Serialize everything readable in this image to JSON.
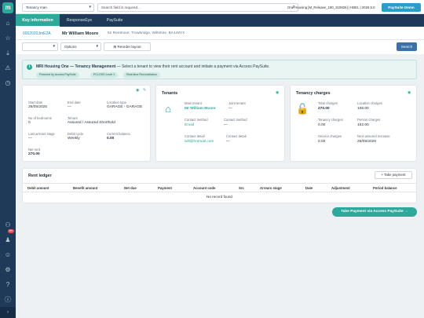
{
  "sidebar": {
    "logo": "m",
    "badge": "99+",
    "collapse_arrow": "›"
  },
  "topbar": {
    "entity_select": "Tenancy man",
    "search_placeholder": "Search field is required...",
    "env": "One Housing [M_Release_190_310826] | HBEL | 2026.5.0",
    "demo_button": "PaySuite Demo"
  },
  "tabs": [
    "Key information",
    "ResponseEye",
    "PaySuite"
  ],
  "record": {
    "id": "0002020JmE2A",
    "name": "Mr William Moore",
    "address": "51 Rentmoor, Trowbridge, Wiltshire, BA148YX"
  },
  "toolbar": {
    "select1": "",
    "options_label": "Options",
    "reorder_label": "Reorder layout",
    "search_label": "Search"
  },
  "banner": {
    "title": "MRI Housing One — Tenancy Management",
    "text": " — Select a tenant to view their rent account and initiate a payment via Access PaySuite.",
    "pills": [
      "Powered by Access PaySuite",
      "PCI-DSS Level 1",
      "Real-time Reconciliation"
    ]
  },
  "tenancy_card": {
    "fields": [
      {
        "label": "Start date",
        "value": "26/05/2025"
      },
      {
        "label": "End date",
        "value": "—"
      },
      {
        "label": "Location type",
        "value": "GARAGE - GARAGE"
      },
      {
        "label": "No of bedrooms",
        "value": "0"
      },
      {
        "label": "Tenure",
        "value": "Assured / Assured Shorthold"
      },
      {
        "label": "Last arrears stage",
        "value": "—"
      },
      {
        "label": "Debit cycle",
        "value": "Weekly"
      },
      {
        "label": "Current balance",
        "value": "0.00"
      },
      {
        "label": "Net rent",
        "value": "270.00"
      }
    ]
  },
  "tenants_card": {
    "title": "Tenants",
    "main_tenant_label": "Main tenant",
    "main_tenant_value": "Mr William Moore",
    "joint_tenant_label": "Joint tenant",
    "joint_tenant_value": "—",
    "contact_method_label": "Contact method",
    "contact_method_value": "Email",
    "contact_method2_label": "Contact method",
    "contact_method2_value": "—",
    "contact_detail_label": "Contact detail",
    "contact_detail_value": "will@hotmail.com",
    "contact_detail2_label": "Contact detail",
    "contact_detail2_value": "—"
  },
  "charges_card": {
    "title": "Tenancy charges",
    "fields": [
      {
        "label": "Total charges",
        "value": "270.00"
      },
      {
        "label": "Location charges",
        "value": "108.00"
      },
      {
        "label": "Tenancy charges",
        "value": "0.00"
      },
      {
        "label": "Person charges",
        "value": "162.00"
      },
      {
        "label": "Service charges",
        "value": "0.00"
      },
      {
        "label": "Next assured increase",
        "value": "26/05/2026"
      }
    ]
  },
  "ledger": {
    "title": "Rent ledger",
    "take_payment": "+ Take payment",
    "columns": [
      "Debit amount",
      "Benefit amount",
      "Net due",
      "Payment",
      "Account code",
      "Src",
      "Arrears stage",
      "Date",
      "Adjustment",
      "Period balance"
    ],
    "empty": "No record found"
  },
  "pay_button": "Take Payment via Access PaySuite →"
}
